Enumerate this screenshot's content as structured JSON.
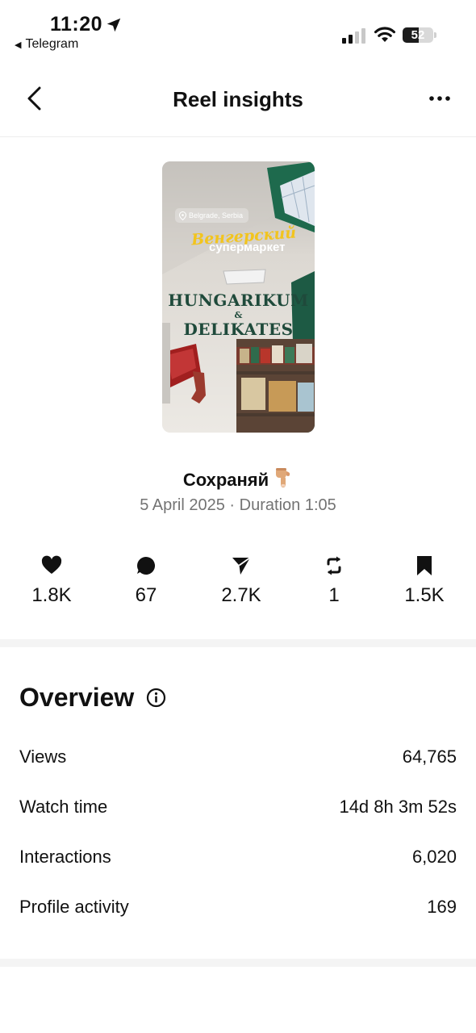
{
  "status_bar": {
    "time": "11:20",
    "back_app": "Telegram",
    "battery_percent": "52",
    "battery_level": 0.52
  },
  "header": {
    "title": "Reel insights"
  },
  "reel": {
    "thumbnail": {
      "location": "Belgrade, Serbia",
      "overlay_line1": "Венгерский",
      "overlay_line2": "супермаркет",
      "sign_line1": "HUNGARIKUM",
      "sign_amp": "&",
      "sign_line2": "DELIKATES"
    },
    "caption": "Сохраняй",
    "caption_emoji": "hand-pointing-down-emoji",
    "date": "5 April 2025",
    "separator": "·",
    "duration_label": "Duration",
    "duration": "1:05"
  },
  "stats": [
    {
      "icon": "heart-icon",
      "value": "1.8K"
    },
    {
      "icon": "comment-icon",
      "value": "67"
    },
    {
      "icon": "share-icon",
      "value": "2.7K"
    },
    {
      "icon": "repost-icon",
      "value": "1"
    },
    {
      "icon": "bookmark-icon",
      "value": "1.5K"
    }
  ],
  "overview": {
    "title": "Overview",
    "rows": [
      {
        "label": "Views",
        "value": "64,765"
      },
      {
        "label": "Watch time",
        "value": "14d 8h 3m 52s"
      },
      {
        "label": "Interactions",
        "value": "6,020"
      },
      {
        "label": "Profile activity",
        "value": "169"
      }
    ]
  },
  "colors": {
    "text": "#111111",
    "muted": "#737373",
    "divider": "#f4f4f4",
    "sign_green": "#1f4a3b",
    "overlay_yellow": "#f2c41d"
  }
}
